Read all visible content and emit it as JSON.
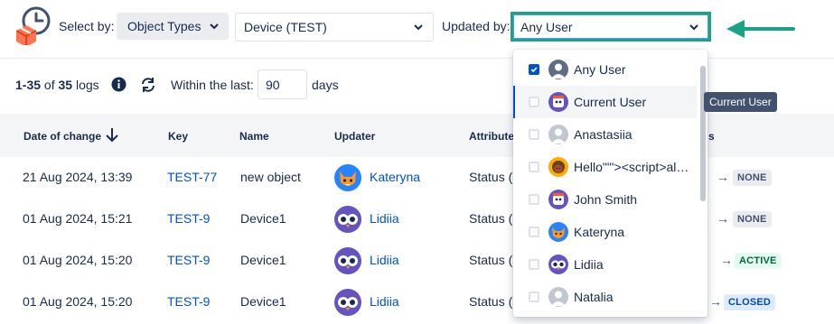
{
  "filters": {
    "select_by_label": "Select by:",
    "object_types_label": "Object Types",
    "object_type_value": "Device (TEST)",
    "updated_by_label": "Updated by:",
    "updated_by_value": "Any User"
  },
  "logs": {
    "range": "1-35",
    "of": "of",
    "total": "35",
    "logs_word": "logs",
    "within_label": "Within the last:",
    "days_value": "90",
    "days_label": "days"
  },
  "table": {
    "columns": [
      "Date of change",
      "Key",
      "Name",
      "Updater",
      "Attribute",
      "s"
    ],
    "rows": [
      {
        "date": "21 Aug 2024, 13:39",
        "key": "TEST-77",
        "name": "new object",
        "updater": "Kateryna",
        "avatar": "fox-avatar",
        "attribute": "Status (",
        "new_status": "NONE",
        "status_color": "none"
      },
      {
        "date": "01 Aug 2024, 15:21",
        "key": "TEST-9",
        "name": "Device1",
        "updater": "Lidiia",
        "avatar": "owl-avatar",
        "attribute": "Status (",
        "new_status": "NONE",
        "status_color": "none"
      },
      {
        "date": "01 Aug 2024, 15:20",
        "key": "TEST-9",
        "name": "Device1",
        "updater": "Lidiia",
        "avatar": "owl-avatar",
        "attribute": "Status (",
        "new_status": "ACTIVE",
        "status_color": "active"
      },
      {
        "date": "01 Aug 2024, 15:20",
        "key": "TEST-9",
        "name": "Device1",
        "updater": "Lidiia",
        "avatar": "owl-avatar",
        "attribute": "Status (",
        "new_status": "CLOSED",
        "status_color": "closed"
      }
    ]
  },
  "dropdown": {
    "options": [
      {
        "label": "Any User",
        "checked": true,
        "avatar": "default-user-avatar"
      },
      {
        "label": "Current User",
        "checked": false,
        "avatar": "robot-avatar"
      },
      {
        "label": "Anastasiia",
        "checked": false,
        "avatar": "default-user-avatar"
      },
      {
        "label": "Hello\"\"'><script>al…",
        "checked": false,
        "avatar": "person-avatar"
      },
      {
        "label": "John Smith",
        "checked": false,
        "avatar": "robot-avatar"
      },
      {
        "label": "Kateryna",
        "checked": false,
        "avatar": "fox-avatar"
      },
      {
        "label": "Lidiia",
        "checked": false,
        "avatar": "owl-avatar"
      },
      {
        "label": "Natalia",
        "checked": false,
        "avatar": "default-user-avatar"
      }
    ],
    "tooltip": "Current User"
  },
  "colors": {
    "accent": "#0052cc",
    "highlight_border": "#1aa385",
    "annotation_arrow": "#1aa385"
  }
}
